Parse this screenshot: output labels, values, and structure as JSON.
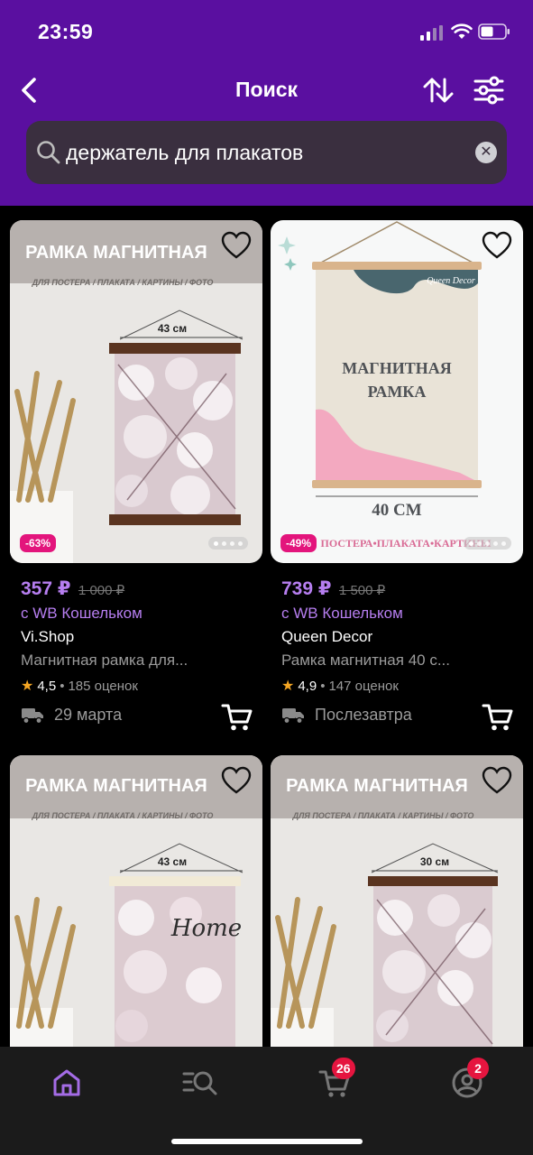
{
  "status": {
    "time": "23:59"
  },
  "nav": {
    "title": "Поиск"
  },
  "search": {
    "query": "держатель для плакатов"
  },
  "products": [
    {
      "discount": "-63%",
      "price": "357 ₽",
      "old_price": "1 000 ₽",
      "wallet": "с WB Кошельком",
      "brand": "Vi.Shop",
      "name": "Магнитная рамка для...",
      "rating": "4,5",
      "reviews": "185 оценок",
      "delivery": "29 марта",
      "image": {
        "banner": "РАМКА МАГНИТНАЯ",
        "subtitle": "ДЛЯ ПОСТЕРА / ПЛАКАТА / КАРТИНЫ / ФОТО",
        "size": "43 см"
      }
    },
    {
      "discount": "-49%",
      "price": "739 ₽",
      "old_price": "1 500 ₽",
      "wallet": "с WB Кошельком",
      "brand": "Queen Decor",
      "name": "Рамка магнитная 40 с...",
      "rating": "4,9",
      "reviews": "147 оценок",
      "delivery": "Послезавтра",
      "image": {
        "logo": "Queen Decor",
        "line1": "МАГНИТНАЯ",
        "line2": "РАМКА",
        "size": "40 СМ",
        "footer": "ПОСТЕРА•ПЛАКАТА•КАРТИНЫ"
      }
    },
    {
      "image": {
        "banner": "РАМКА МАГНИТНАЯ",
        "subtitle": "ДЛЯ ПОСТЕРА / ПЛАКАТА / КАРТИНЫ / ФОТО",
        "size": "43 см",
        "script": "Home"
      }
    },
    {
      "image": {
        "banner": "РАМКА МАГНИТНАЯ",
        "subtitle": "ДЛЯ ПОСТЕРА / ПЛАКАТА / КАРТИНЫ / ФОТО",
        "size": "30 см"
      }
    }
  ],
  "tabs": {
    "cart_badge": "26",
    "profile_badge": "2"
  },
  "colors": {
    "header": "#5a0fa0",
    "price": "#b67ef0",
    "discount": "#e3157c",
    "badge": "#e5153f"
  }
}
